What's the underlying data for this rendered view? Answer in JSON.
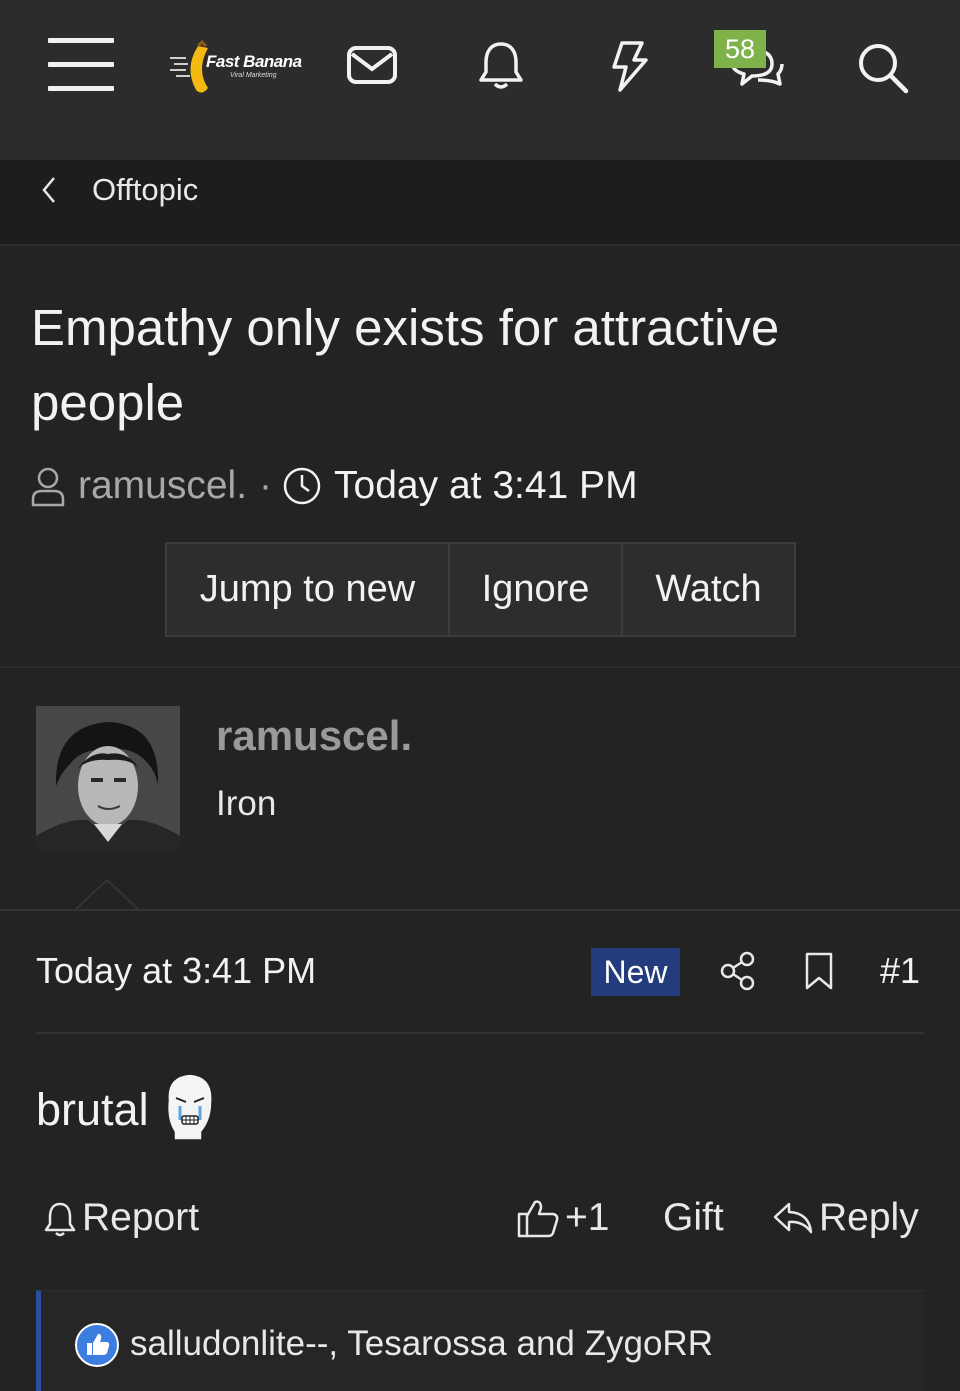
{
  "header": {
    "logo": {
      "name": "Fast Banana",
      "tagline": "Viral Marketing"
    },
    "notifications_badge": "58",
    "icons": [
      "menu-icon",
      "mail-icon",
      "bell-icon",
      "lightning-icon",
      "chat-icon",
      "search-icon"
    ]
  },
  "breadcrumb": {
    "label": "Offtopic"
  },
  "thread": {
    "title": "Empathy only exists for attractive people",
    "author": "ramuscel.",
    "separator": "·",
    "time": "Today at 3:41 PM"
  },
  "buttons": {
    "jump": "Jump to new",
    "ignore": "Ignore",
    "watch": "Watch"
  },
  "post": {
    "author_name": "ramuscel.",
    "author_rank": "Iron",
    "time": "Today at 3:41 PM",
    "new_label": "New",
    "number": "#1",
    "body": "brutal",
    "actions": {
      "report": "Report",
      "like": "+1",
      "gift": "Gift",
      "reply": "Reply"
    },
    "reactions": "salludonlite--, Tesarossa and ZygoRR"
  },
  "colors": {
    "badge": "#7fb24a",
    "new": "#233c7d",
    "reaction_bar": "#2b4ea0",
    "background": "#232323"
  }
}
